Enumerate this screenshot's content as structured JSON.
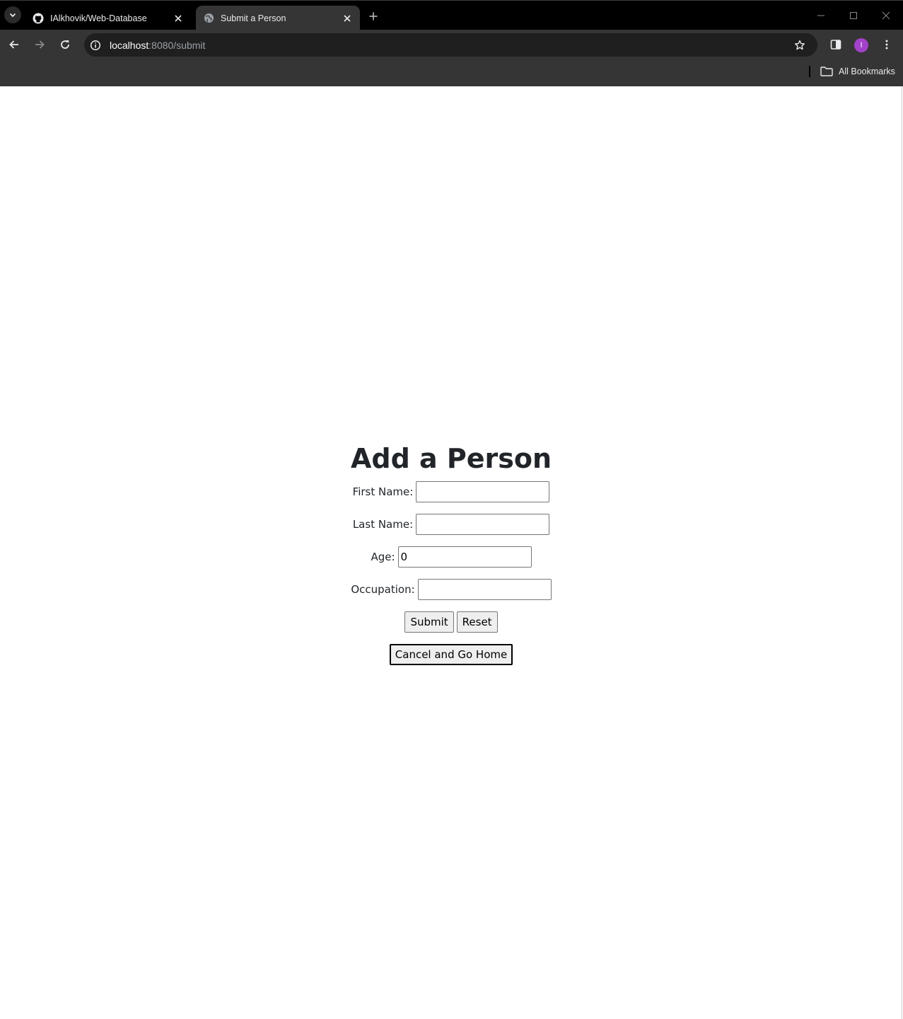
{
  "browser": {
    "tabs": [
      {
        "title": "IAlkhovik/Web-Database",
        "favicon": "github-icon",
        "active": false
      },
      {
        "title": "Submit a Person",
        "favicon": "globe-icon",
        "active": true
      }
    ],
    "address": {
      "host": "localhost",
      "path": ":8080/submit"
    },
    "profile_initial": "I",
    "bookmarks_label": "All Bookmarks",
    "accent_colors": {
      "frame": "#000000",
      "toolbar": "#353535",
      "omnibox": "#1f1f1f",
      "avatar": "#a142c9"
    }
  },
  "page": {
    "heading": "Add a Person",
    "fields": {
      "first_name": {
        "label": "First Name:",
        "value": ""
      },
      "last_name": {
        "label": "Last Name:",
        "value": ""
      },
      "age": {
        "label": "Age:",
        "value": "0"
      },
      "occupation": {
        "label": "Occupation:",
        "value": ""
      }
    },
    "buttons": {
      "submit": "Submit",
      "reset": "Reset",
      "cancel": "Cancel and Go Home"
    }
  }
}
